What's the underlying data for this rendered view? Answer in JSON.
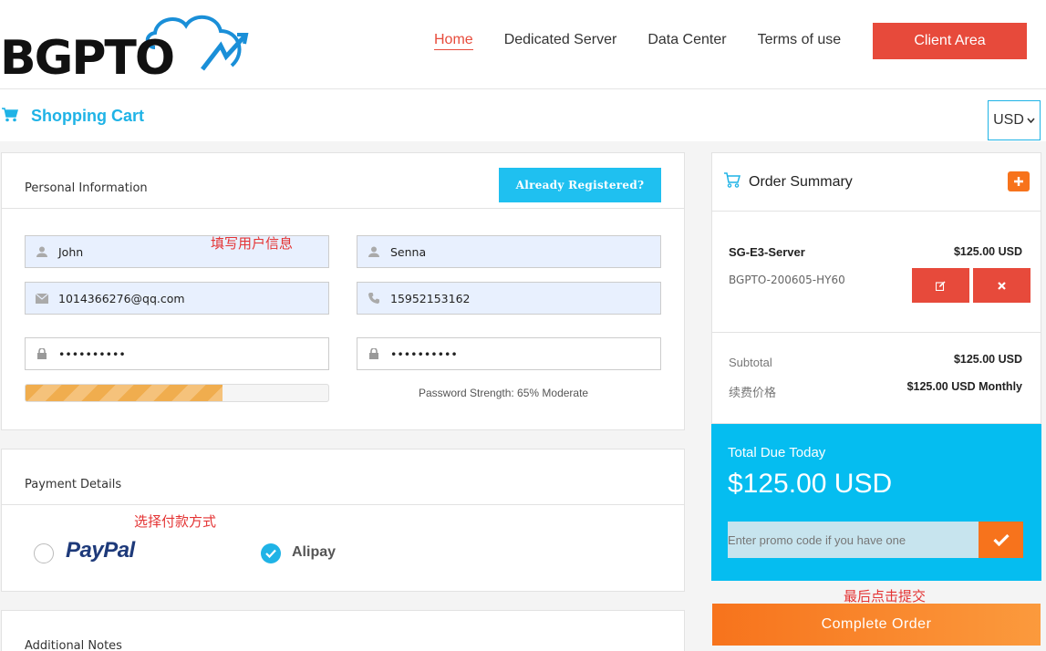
{
  "brand": {
    "logo_text": "BGPTO"
  },
  "nav": {
    "items": [
      "Home",
      "Dedicated Server",
      "Data Center",
      "Terms of use"
    ],
    "active": "Home",
    "client_area": "Client Area"
  },
  "cart": {
    "title": "Shopping Cart",
    "currency": "USD"
  },
  "personal": {
    "title": "Personal Information",
    "already_registered": "Already Registered?",
    "first_name": "John",
    "last_name": "Senna",
    "email": "1014366276@qq.com",
    "phone": "15952153162",
    "password": "••••••••••",
    "password_confirm": "••••••••••",
    "strength_percent": 65,
    "strength_text": "Password Strength: 65% Moderate"
  },
  "payment": {
    "title": "Payment Details",
    "options": [
      {
        "label": "PayPal",
        "selected": false
      },
      {
        "label": "Alipay",
        "selected": true
      }
    ]
  },
  "notes": {
    "title": "Additional Notes"
  },
  "annotations": {
    "fill_info": "填写用户信息",
    "choose_payment": "选择付款方式",
    "submit_last": "最后点击提交"
  },
  "summary": {
    "title": "Order Summary",
    "item_name": "SG-E3-Server",
    "item_price": "$125.00 USD",
    "item_id": "BGPTO-200605-HY60",
    "subtotal_label": "Subtotal",
    "subtotal_value": "$125.00 USD",
    "renewal_label": "续费价格",
    "renewal_value": "$125.00 USD Monthly"
  },
  "total": {
    "label": "Total Due Today",
    "amount": "$125.00 USD",
    "promo_placeholder": "Enter promo code if you have one"
  },
  "complete_order": "Complete Order",
  "colors": {
    "accent": "#1fb3e6",
    "red": "#e74a3b",
    "orange": "#f7731c",
    "total_bg": "#05bdf0"
  }
}
